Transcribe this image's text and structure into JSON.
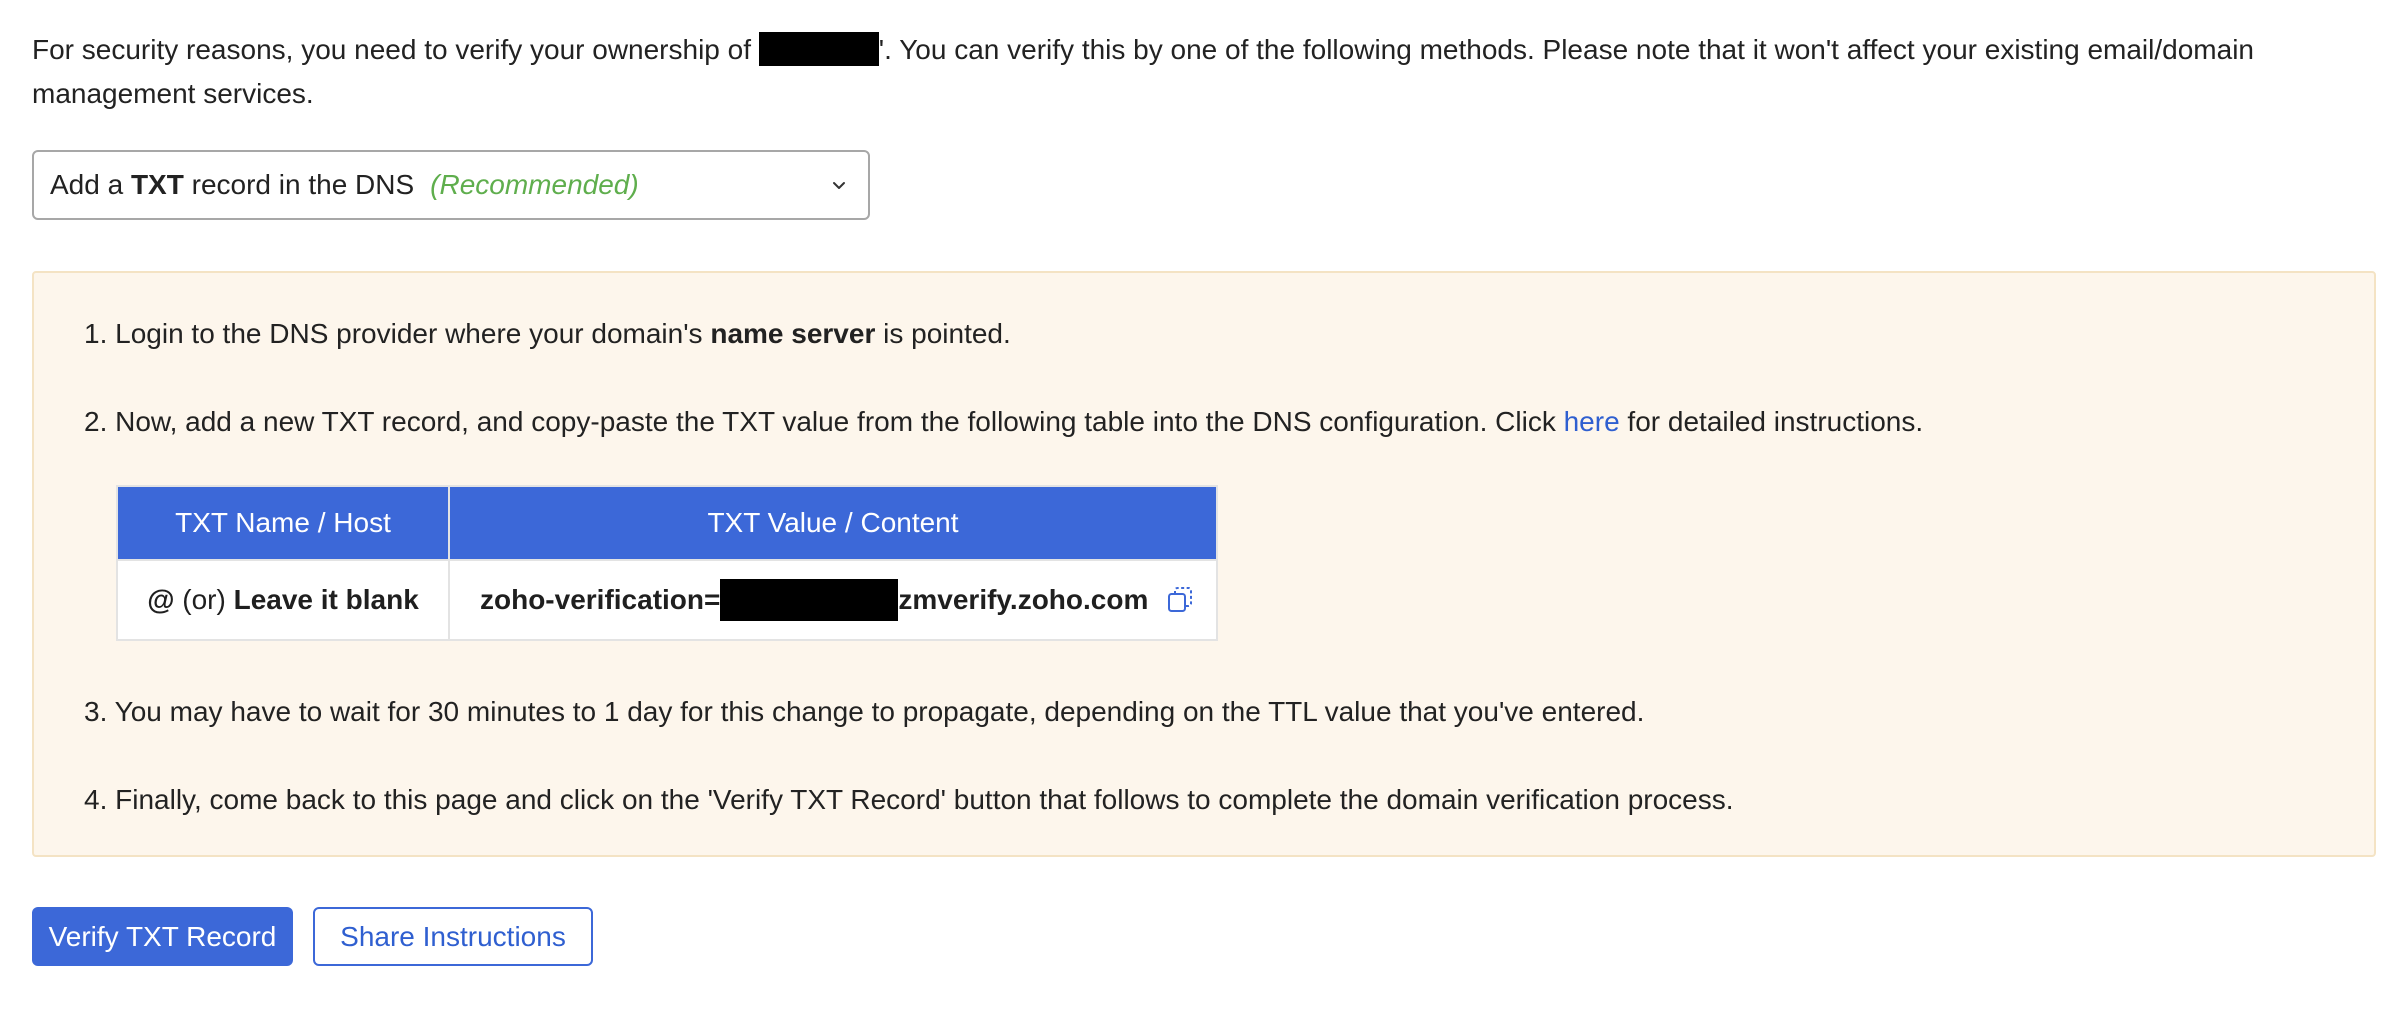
{
  "intro": {
    "before_domain": "For security reasons, you need to verify your ownership of ",
    "after_domain": "'. You can verify this by one of the following methods. Please note that it won't affect your existing email/domain management services."
  },
  "method_select": {
    "prefix": "Add a ",
    "bold": "TXT",
    "suffix": " record in the DNS",
    "recommended": "(Recommended)"
  },
  "steps": {
    "s1": {
      "before": "1. Login to the DNS provider where your domain's ",
      "bold": "name server",
      "after": " is pointed."
    },
    "s2": {
      "before": "2. Now, add a new TXT record, and copy-paste the TXT value from the following table into the DNS configuration. Click ",
      "link": "here",
      "after": " for detailed instructions."
    },
    "s3": "3. You may have to wait for 30 minutes to 1 day for this change to propagate, depending on the TTL value that you've entered.",
    "s4": "4. Finally, come back to this page and click on the 'Verify TXT Record' button that follows to complete the domain verification process."
  },
  "table": {
    "header_host": "TXT Name / Host",
    "header_value": "TXT Value / Content",
    "host_at": "@",
    "host_or": " (or) ",
    "host_blank": "Leave it blank",
    "value_prefix": "zoho-verification=",
    "value_suffix": "zmverify.zoho.com"
  },
  "buttons": {
    "verify": "Verify TXT Record",
    "share": "Share Instructions"
  },
  "colors": {
    "accent": "#3c68d8",
    "recommended": "#5fae4d",
    "panel_bg": "#fdf6ec",
    "link": "#2f5fd0"
  },
  "icons": {
    "dropdown": "chevron-down-icon",
    "copy": "copy-icon"
  }
}
